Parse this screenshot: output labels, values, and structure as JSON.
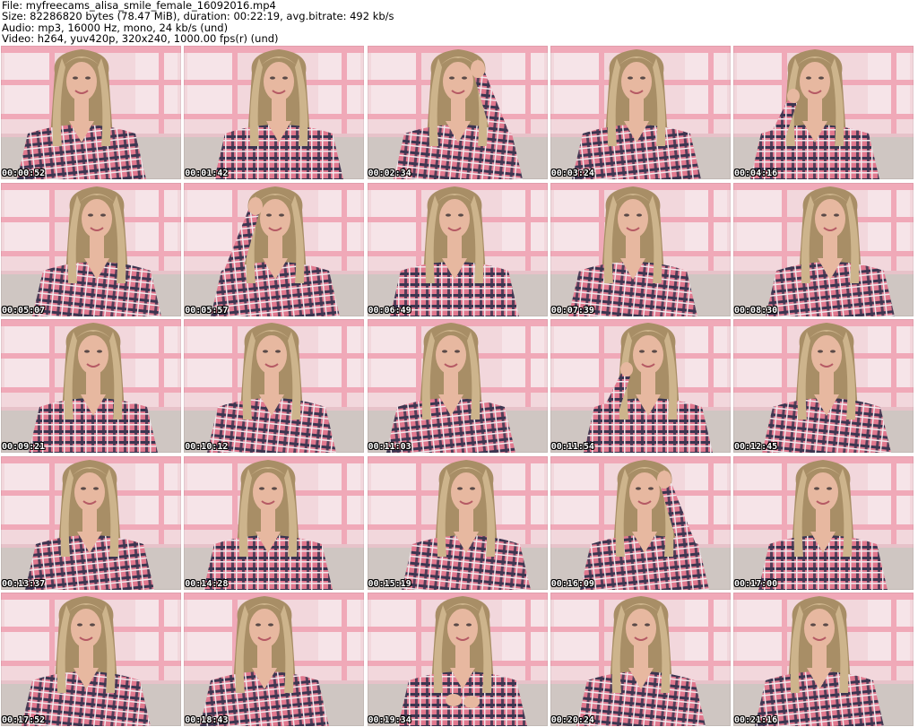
{
  "header": {
    "file_line": "File: myfreecams_alisa_smile_female_16092016.mp4",
    "size_line": "Size: 82286820 bytes (78.47 MiB), duration: 00:22:19, avg.bitrate: 492 kb/s",
    "audio_line": "Audio: mp3, 16000 Hz, mono, 24 kb/s (und)",
    "video_line": "Video: h264, yuv420p, 320x240, 1000.00 fps(r) (und)"
  },
  "thumbnails": [
    {
      "timestamp": "00:00:52",
      "pose": "center"
    },
    {
      "timestamp": "00:01:42",
      "pose": "center"
    },
    {
      "timestamp": "00:02:34",
      "pose": "hand-up-right"
    },
    {
      "timestamp": "00:03:24",
      "pose": "center"
    },
    {
      "timestamp": "00:04:16",
      "pose": "hand-hair-left"
    },
    {
      "timestamp": "00:05:07",
      "pose": "center"
    },
    {
      "timestamp": "00:05:57",
      "pose": "hand-up-left"
    },
    {
      "timestamp": "00:06:49",
      "pose": "center"
    },
    {
      "timestamp": "00:07:39",
      "pose": "center"
    },
    {
      "timestamp": "00:08:30",
      "pose": "center"
    },
    {
      "timestamp": "00:09:21",
      "pose": "center"
    },
    {
      "timestamp": "00:10:12",
      "pose": "center"
    },
    {
      "timestamp": "00:11:03",
      "pose": "center"
    },
    {
      "timestamp": "00:11:54",
      "pose": "hand-hair-left"
    },
    {
      "timestamp": "00:12:45",
      "pose": "center"
    },
    {
      "timestamp": "00:13:37",
      "pose": "center"
    },
    {
      "timestamp": "00:14:28",
      "pose": "center"
    },
    {
      "timestamp": "00:15:19",
      "pose": "center"
    },
    {
      "timestamp": "00:16:09",
      "pose": "hand-up-right"
    },
    {
      "timestamp": "00:17:00",
      "pose": "center"
    },
    {
      "timestamp": "00:17:52",
      "pose": "center"
    },
    {
      "timestamp": "00:18:43",
      "pose": "center"
    },
    {
      "timestamp": "00:19:34",
      "pose": "hands-chest"
    },
    {
      "timestamp": "00:20:24",
      "pose": "center"
    },
    {
      "timestamp": "00:21:16",
      "pose": "center"
    }
  ],
  "colors": {
    "wall": "#f2d7dc",
    "wall_shadow": "#e7c2c9",
    "shelf_pink": "#f0a9b8",
    "shelf_light": "#f6e4e8",
    "hair": "#cdb48c",
    "hair_shadow": "#a88e66",
    "skin": "#e7b8a0",
    "shirt_pink": "#e0788e",
    "shirt_dark": "#3b3550",
    "shirt_white": "#f1e8ec",
    "sofa": "#cfc6c2"
  }
}
